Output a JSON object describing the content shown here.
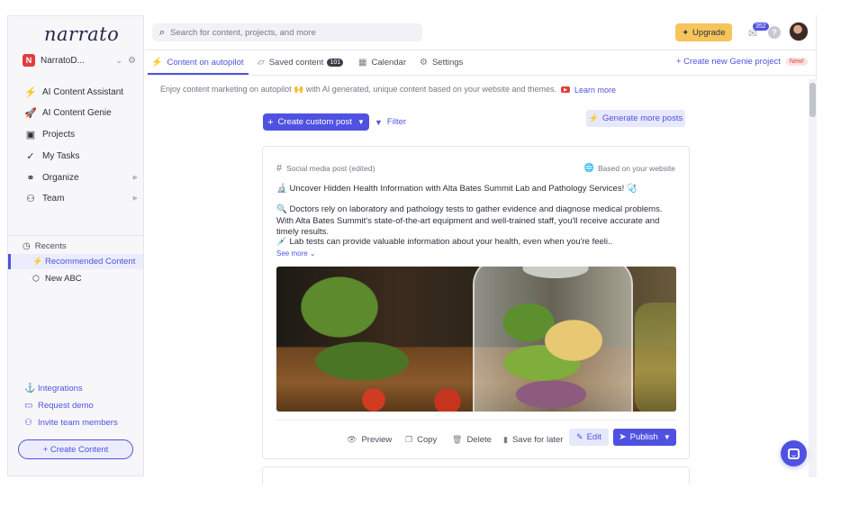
{
  "app": {
    "logo": "narrato"
  },
  "workspace": {
    "initial": "N",
    "name": "NarratoD..."
  },
  "sidebar": {
    "items": [
      {
        "label": "AI Content Assistant",
        "icon": "⚡",
        "icon_name": "lightning-icon"
      },
      {
        "label": "AI Content Genie",
        "icon": "🚀",
        "icon_name": "rocket-icon"
      },
      {
        "label": "Projects",
        "icon": "▣",
        "icon_name": "briefcase-icon"
      },
      {
        "label": "My Tasks",
        "icon": "✓",
        "icon_name": "check-icon"
      },
      {
        "label": "Organize",
        "icon": "⚭",
        "icon_name": "organize-icon",
        "has_submenu": true
      },
      {
        "label": "Team",
        "icon": "⚇",
        "icon_name": "team-icon",
        "has_submenu": true
      }
    ],
    "recents_title": "Recents",
    "recents": [
      {
        "label": "Recommended Content",
        "icon": "⚡",
        "active": true
      },
      {
        "label": "New ABC",
        "icon": "⬡",
        "active": false
      }
    ],
    "footer": [
      {
        "label": "Integrations",
        "icon": "⚓"
      },
      {
        "label": "Request demo",
        "icon": "▭"
      },
      {
        "label": "Invite team members",
        "icon": "⚇"
      }
    ],
    "create_label": "+ Create Content"
  },
  "header": {
    "search_placeholder": "Search for content, projects, and more",
    "upgrade_label": "Upgrade",
    "notification_count": "352"
  },
  "tabs": [
    {
      "label": "Content on autopilot",
      "active": true
    },
    {
      "label": "Saved content",
      "count": "101"
    },
    {
      "label": "Calendar"
    },
    {
      "label": "Settings"
    }
  ],
  "new_genie": {
    "label": "+ Create new Genie project",
    "badge": "New!"
  },
  "tagline": {
    "text": "Enjoy content marketing on autopilot 🙌 with AI generated, unique content based on your website and themes.",
    "link": "Learn more"
  },
  "actions": {
    "create_custom": "Create custom post",
    "filter": "Filter",
    "generate_more": "Generate more posts"
  },
  "post": {
    "type": "Social media post (edited)",
    "source": "Based on your website",
    "lines": [
      "🔬 Uncover Hidden Health Information with Alta Bates Summit Lab and Pathology Services! 🩺",
      "🔍 Doctors rely on laboratory and pathology tests to gather evidence and diagnose medical problems. With Alta Bates Summit's state-of-the-art equipment and well-trained staff, you'll receive accurate and timely results.",
      "💉 Lab tests can provide valuable information about your health, even when you're feeli.."
    ],
    "see_more": "See more",
    "image_subject": "salad jar",
    "buttons": {
      "preview": "Preview",
      "copy": "Copy",
      "delete": "Delete",
      "save_later": "Save for later",
      "edit": "Edit",
      "publish": "Publish"
    }
  },
  "colors": {
    "accent": "#4f52e0",
    "upgrade": "#f5c55c",
    "badge_red": "#e03e3e"
  }
}
